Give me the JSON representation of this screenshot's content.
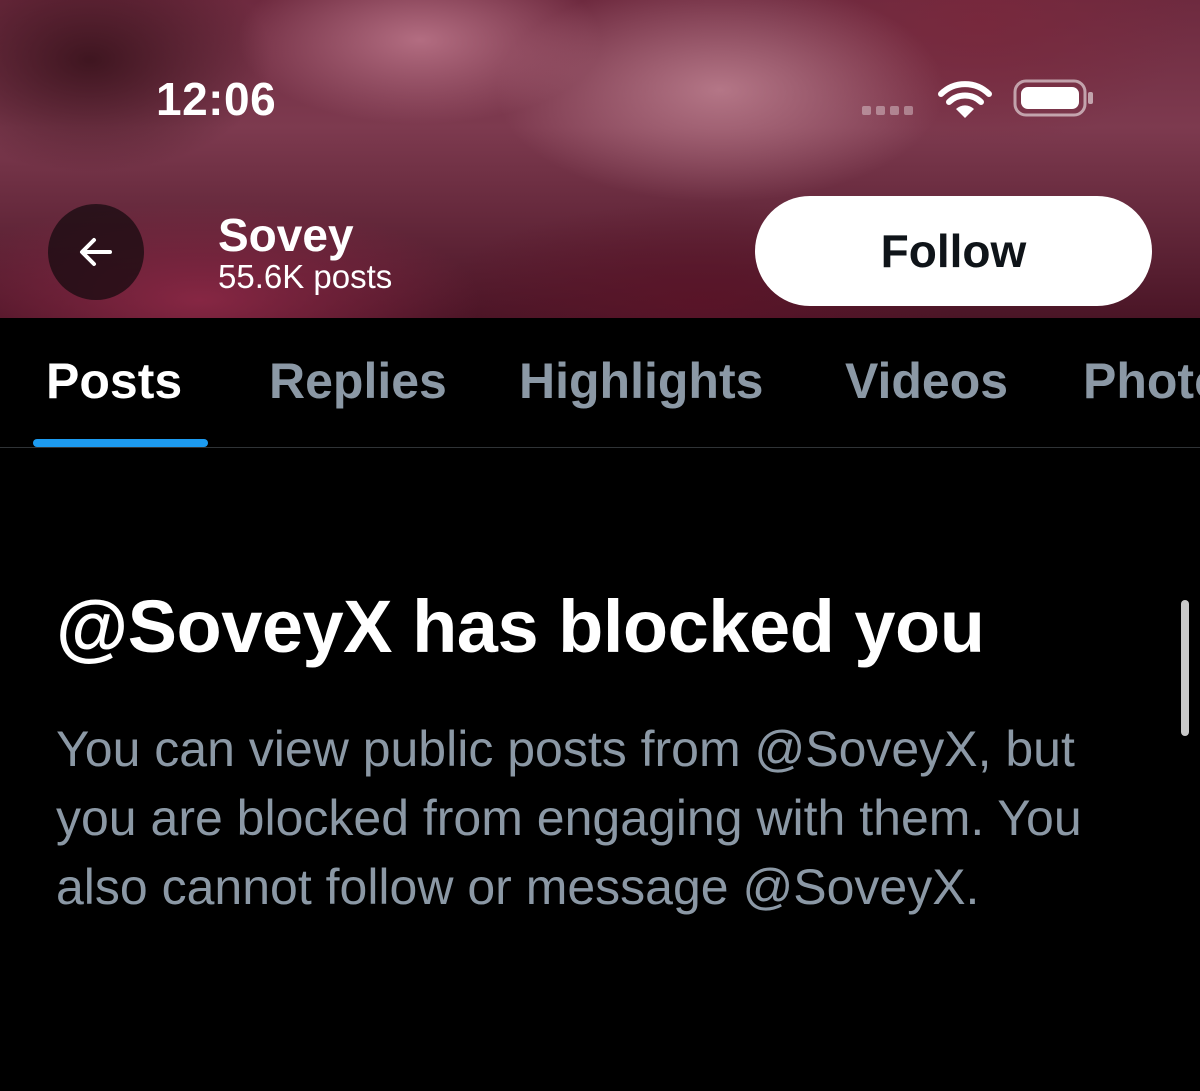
{
  "status_bar": {
    "time": "12:06"
  },
  "header": {
    "back_icon": "arrow-left-icon",
    "profile_name": "Sovey",
    "post_count": "55.6K posts",
    "follow_label": "Follow"
  },
  "tabs": [
    {
      "label": "Posts",
      "active": true
    },
    {
      "label": "Replies",
      "active": false
    },
    {
      "label": "Highlights",
      "active": false
    },
    {
      "label": "Videos",
      "active": false
    },
    {
      "label": "Photos",
      "active": false
    }
  ],
  "blocked": {
    "title": "@SoveyX has blocked you",
    "message": "You can view public posts from @SoveyX, but you are blocked from engaging with them. You also cannot follow or message @SoveyX."
  },
  "colors": {
    "accent": "#1d9bf0",
    "secondary_text": "#8b98a5",
    "background": "#000000"
  }
}
